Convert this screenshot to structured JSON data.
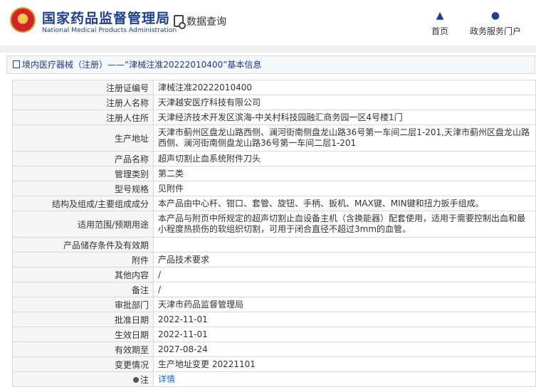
{
  "header": {
    "brand_cn": "国家药品监督管理局",
    "brand_en": "National Medical Products Administration",
    "query_label": "数据查询",
    "nav": [
      {
        "label": "首页",
        "icon": "home-icon"
      },
      {
        "label": "政务服务门户",
        "icon": "user-icon"
      }
    ]
  },
  "breadcrumb": {
    "text": "境内医疗器械（注册）——“津械注准20222010400”基本信息"
  },
  "rows": [
    {
      "key": "注册证编号",
      "value": "津械注准20222010400"
    },
    {
      "key": "注册人名称",
      "value": "天津越安医疗科技有限公司"
    },
    {
      "key": "注册人住所",
      "value": "天津经济技术开发区滨海-中关村科技园融汇商务园一区4号楼1门"
    },
    {
      "key": "生产地址",
      "value": "天津市蓟州区盘龙山路西侧、澜河街南侧盘龙山路36号第一车间二层1-201,天津市蓟州区盘龙山路西侧、澜河街南侧盘龙山路36号第一车间二层1-201"
    },
    {
      "key": "产品名称",
      "value": "超声切割止血系统附件刀头"
    },
    {
      "key": "管理类别",
      "value": "第二类"
    },
    {
      "key": "型号规格",
      "value": "见附件"
    },
    {
      "key": "结构及组成/主要组成成分",
      "value": "本产品由中心杆、钳口、套管、旋钮、手柄、扳机、MAX键、MIN键和扭力扳手组成。"
    },
    {
      "key": "适用范围/预期用途",
      "value": "本产品与附页中所规定的超声切割止血设备主机（含换能器）配套使用，适用于需要控制出血和最小程度热损伤的软组织切割，可用于闭合直径不超过3mm的血管。"
    },
    {
      "key": "产品储存条件及有效期",
      "value": ""
    },
    {
      "key": "附件",
      "value": "产品技术要求"
    },
    {
      "key": "其他内容",
      "value": "/"
    },
    {
      "key": "备注",
      "value": "/"
    },
    {
      "key": "审批部门",
      "value": "天津市药品监督管理局"
    },
    {
      "key": "批准日期",
      "value": "2022-11-01"
    },
    {
      "key": "生效日期",
      "value": "2022-11-01"
    },
    {
      "key": "有效期至",
      "value": "2027-08-24"
    },
    {
      "key": "变更情况",
      "value": "生产地址变更 20221101"
    },
    {
      "key": "注",
      "value": "详情"
    }
  ],
  "colors": {
    "brand": "#1c3f8f",
    "link": "#1c6bc4",
    "key_bg": "#f5f5f5",
    "border": "#d9d9d9"
  }
}
